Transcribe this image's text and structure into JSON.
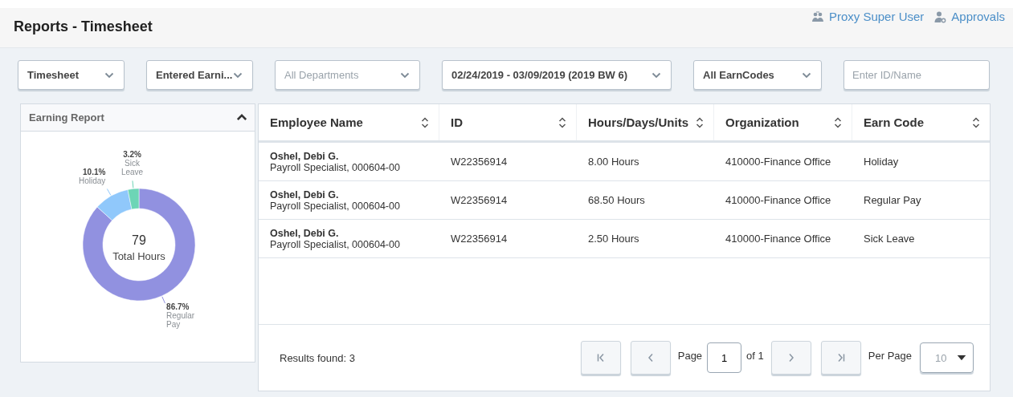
{
  "page_title": "Reports - Timesheet",
  "header_links": [
    {
      "kind": "proxy",
      "label": "Proxy Super User"
    },
    {
      "kind": "approvals",
      "label": "Approvals"
    }
  ],
  "filters": [
    {
      "kind": "select",
      "value": "Timesheet"
    },
    {
      "kind": "select",
      "value": "Entered Earni..."
    },
    {
      "kind": "select",
      "placeholder": "All Departments"
    },
    {
      "kind": "select",
      "value": "02/24/2019 - 03/09/2019 (2019 BW 6)"
    },
    {
      "kind": "select",
      "value": "All EarnCodes"
    },
    {
      "kind": "input",
      "placeholder": "Enter ID/Name"
    }
  ],
  "earning_report": {
    "title": "Earning Report",
    "expanded": true,
    "total": "79",
    "total_label": "Total Hours",
    "chart_data": {
      "type": "donut",
      "categories": [
        "Regular Pay",
        "Holiday",
        "Sick Leave"
      ],
      "values": [
        86.7,
        10.1,
        3.2
      ],
      "colors": [
        "#9191e0",
        "#90c8fb",
        "#6dd5b6"
      ],
      "value_labels": [
        "86.7%",
        "10.1%",
        "3.2%"
      ]
    }
  },
  "table": {
    "columns": [
      "Employee Name",
      "ID",
      "Hours/Days/Units",
      "Organization",
      "Earn Code"
    ],
    "rows": [
      {
        "name": "Oshel, Debi G.",
        "position": "Payroll Specialist, 000604-00",
        "id": "W22356914",
        "hours": "8.00 Hours",
        "organization": "410000-Finance Office",
        "earn_code": "Holiday"
      },
      {
        "name": "Oshel, Debi G.",
        "position": "Payroll Specialist, 000604-00",
        "id": "W22356914",
        "hours": "68.50 Hours",
        "organization": "410000-Finance Office",
        "earn_code": "Regular Pay"
      },
      {
        "name": "Oshel, Debi G.",
        "position": "Payroll Specialist, 000604-00",
        "id": "W22356914",
        "hours": "2.50 Hours",
        "organization": "410000-Finance Office",
        "earn_code": "Sick Leave"
      }
    ]
  },
  "footer": {
    "results": "Results found: 3",
    "page_label": "Page",
    "page": "1",
    "of_pages": "of 1",
    "per_page_label": "Per Page",
    "per_page": "10"
  }
}
